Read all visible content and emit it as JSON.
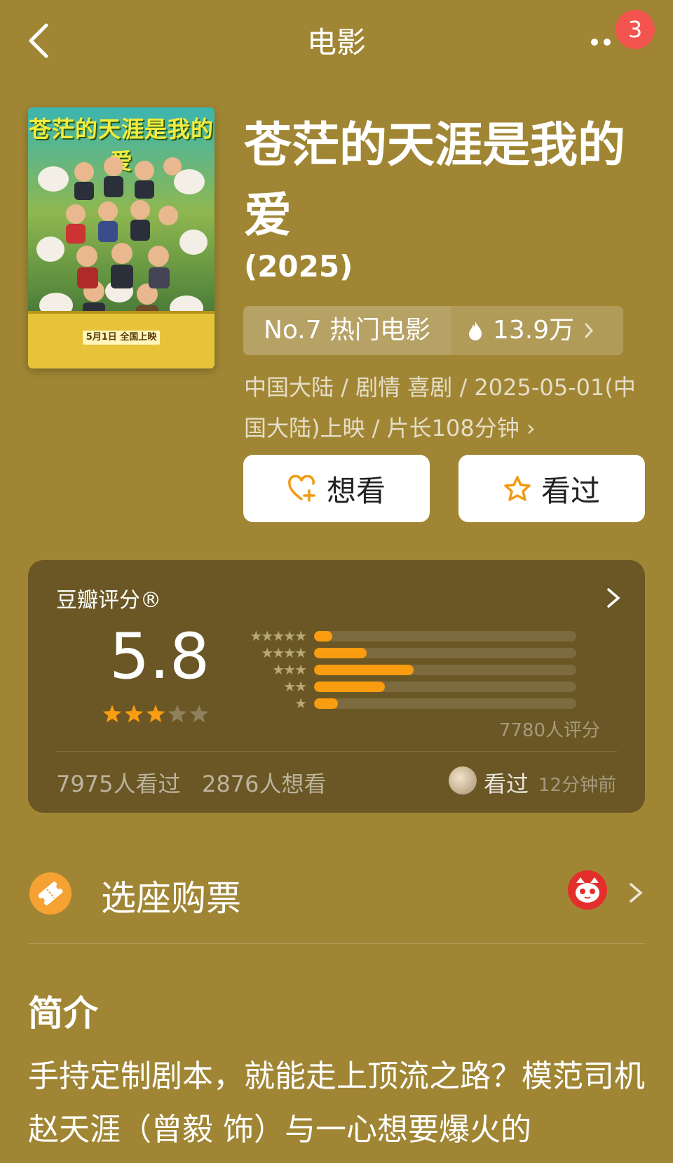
{
  "header": {
    "title": "电影",
    "notification_count": "3"
  },
  "movie": {
    "title": "苍茫的天涯是我的爱",
    "year": "(2025)",
    "poster_title": "苍茫的天涯是我的爱",
    "poster_date": "5月1日 全国上映",
    "rank_label": "No.7 热门电影",
    "heat_value": "13.9万",
    "meta_line": "中国大陆 / 剧情 喜剧 / 2025-05-01(中国大陆)上映 / 片长108分钟 ›"
  },
  "actions": {
    "want_label": "想看",
    "seen_label": "看过"
  },
  "rating": {
    "label": "豆瓣评分®",
    "score": "5.8",
    "stars_filled": 3,
    "stars_total": 5,
    "distribution": [
      {
        "stars": "★★★★★",
        "fraction": 0.07
      },
      {
        "stars": "★★★★",
        "fraction": 0.2
      },
      {
        "stars": "★★★",
        "fraction": 0.38
      },
      {
        "stars": "★★",
        "fraction": 0.27
      },
      {
        "stars": "★",
        "fraction": 0.09
      }
    ],
    "rating_count": "7780人评分",
    "watched": "7975人看过",
    "wanted": "2876人想看",
    "friend_action": "看过",
    "friend_time": "12分钟前"
  },
  "tickets": {
    "label": "选座购票"
  },
  "intro": {
    "heading": "简介",
    "text": "手持定制剧本，就能走上顶流之路？模范司机赵天涯（曾毅 饰）与一心想要爆火的"
  },
  "colors": {
    "background": "#a08634",
    "card": "#6a5725",
    "accent": "#f99c10",
    "badge": "#f4544e"
  }
}
